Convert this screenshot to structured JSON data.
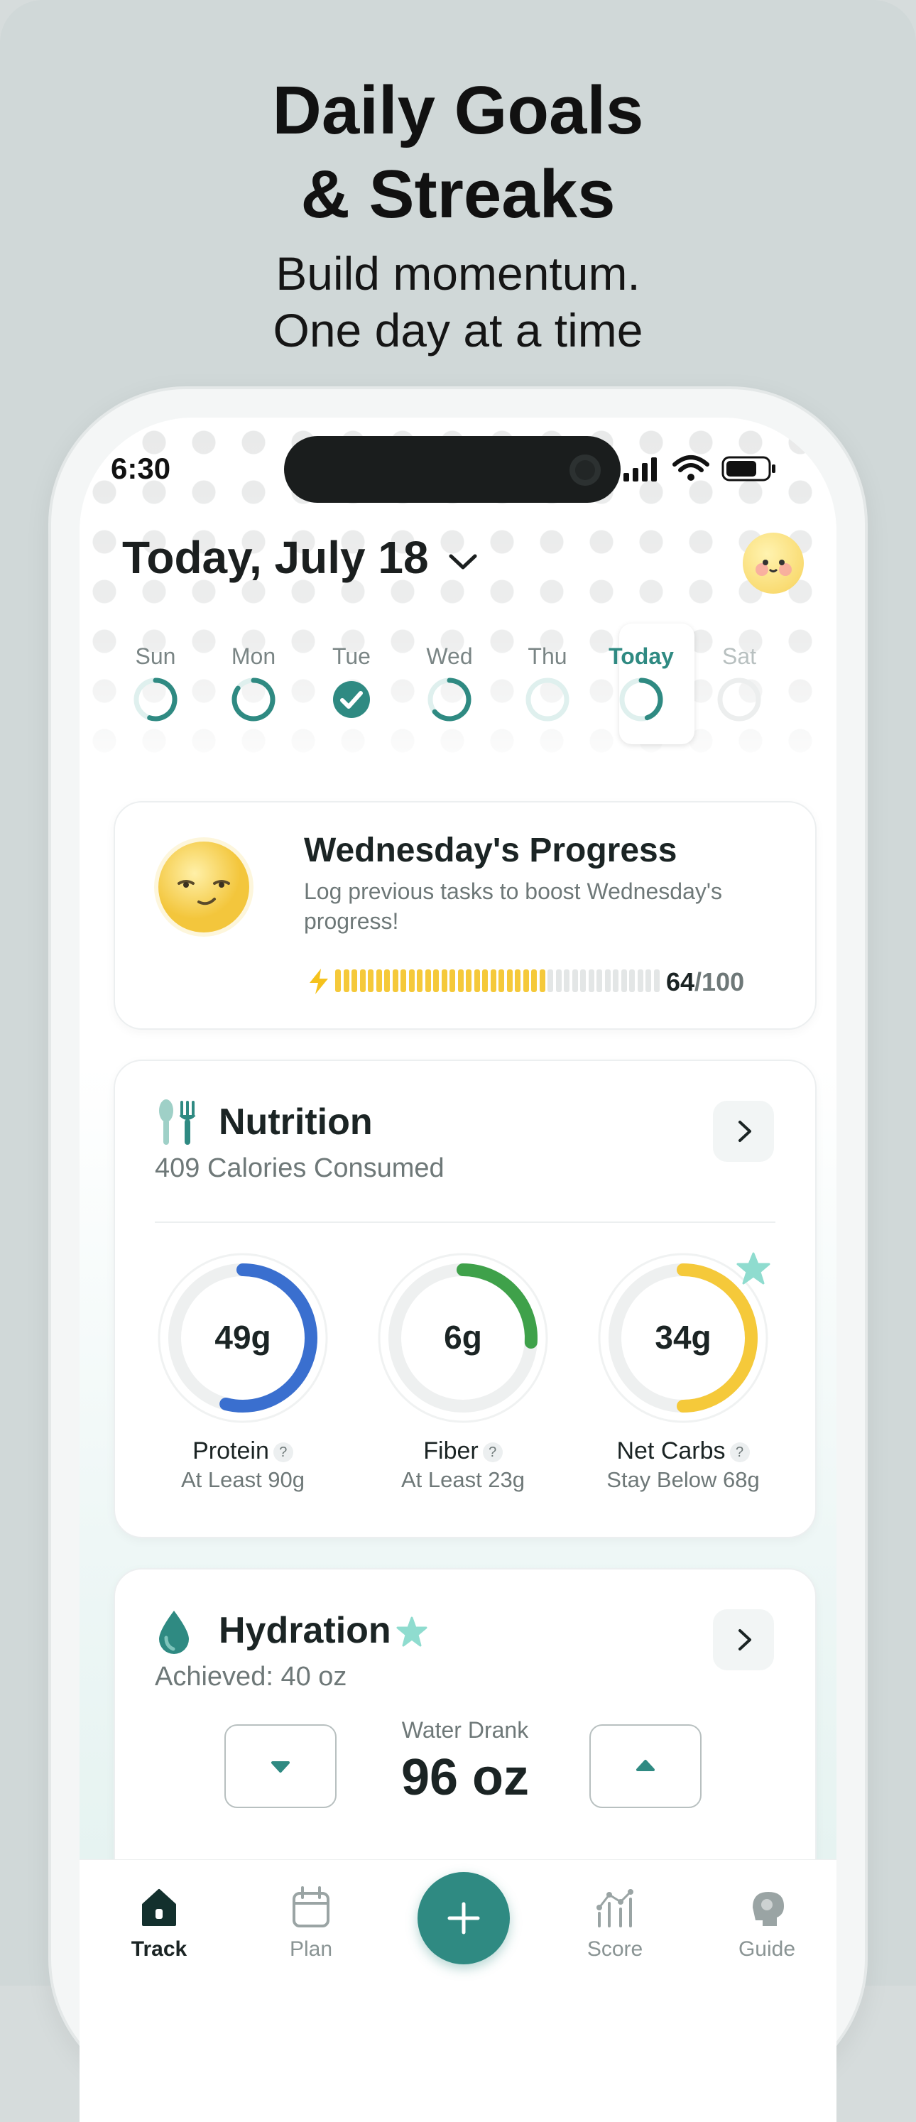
{
  "promo": {
    "headline_line1": "Daily Goals",
    "headline_line2": "& Streaks",
    "sub_line1": "Build momentum.",
    "sub_line2": "One day at a time"
  },
  "status_bar": {
    "time": "6:30"
  },
  "header": {
    "date": "Today, July 18"
  },
  "week": {
    "days": [
      {
        "label": "Sun",
        "progress": 0.55
      },
      {
        "label": "Mon",
        "progress": 0.85
      },
      {
        "label": "Tue",
        "progress": 1.0,
        "completed": true
      },
      {
        "label": "Wed",
        "progress": 0.64
      },
      {
        "label": "Thu",
        "progress": 0.0
      },
      {
        "label": "Today",
        "progress": 0.45,
        "selected": true
      },
      {
        "label": "Sat",
        "progress": 0.0
      }
    ]
  },
  "progress_card": {
    "title": "Wednesday's Progress",
    "description": "Log previous tasks to boost Wednesday's progress!",
    "score": "64",
    "max": "/100",
    "fraction": 0.64
  },
  "nutrition": {
    "title": "Nutrition",
    "subtitle": "409 Calories Consumed",
    "macros": [
      {
        "value": "49g",
        "label": "Protein",
        "goal": "At Least 90g",
        "fraction": 0.54,
        "color": "#3a6fcf"
      },
      {
        "value": "6g",
        "label": "Fiber",
        "goal": "At Least 23g",
        "fraction": 0.26,
        "color": "#3fa14a"
      },
      {
        "value": "34g",
        "label": "Net Carbs",
        "goal": "Stay Below 68g",
        "fraction": 0.5,
        "color": "#f5c93a"
      }
    ]
  },
  "hydration": {
    "title": "Hydration",
    "achieved": "Achieved: 40 oz",
    "water_label": "Water Drank",
    "water_value": "96 oz"
  },
  "tabs": [
    {
      "label": "Track",
      "active": true
    },
    {
      "label": "Plan"
    },
    {
      "label": "Score"
    },
    {
      "label": "Guide"
    }
  ],
  "colors": {
    "accent": "#2f8a82",
    "yellow": "#f5c93a"
  }
}
